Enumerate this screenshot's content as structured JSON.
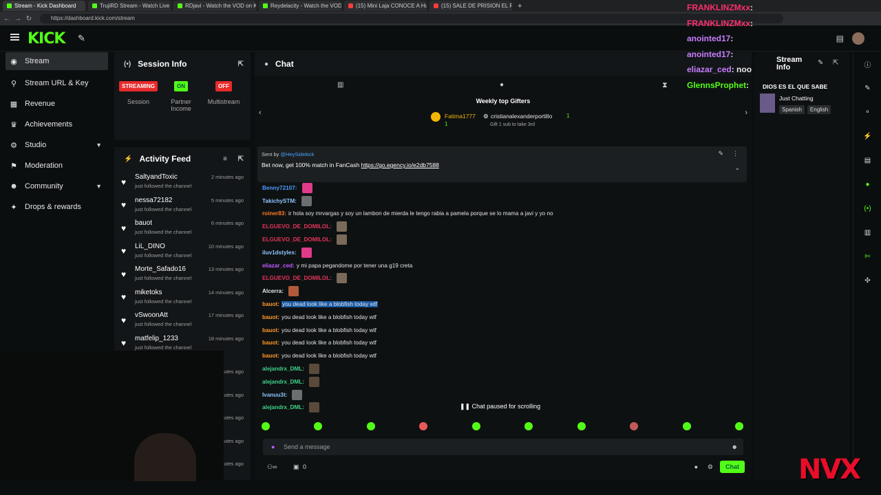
{
  "browser": {
    "tabs": [
      "Stream - Kick Dashboard",
      "TrujiRD Stream - Watch Live on Ki...",
      "RDjavi - Watch the VOD on Kick",
      "Reydelacity - Watch the VOD on ...",
      "(15) Mini Laja CONOCE A Huanc...",
      "(15) SALE DE PRISION EL FAMOSO..."
    ],
    "url": "https://dashboard.kick.com/stream"
  },
  "logo": "KICK",
  "sidebar": {
    "items": [
      {
        "label": "Stream",
        "icon": "record-icon"
      },
      {
        "label": "Stream URL & Key",
        "icon": "link-icon"
      },
      {
        "label": "Revenue",
        "icon": "revenue-icon"
      },
      {
        "label": "Achievements",
        "icon": "trophy-icon"
      },
      {
        "label": "Studio",
        "icon": "gear-icon"
      },
      {
        "label": "Moderation",
        "icon": "moderation-icon"
      },
      {
        "label": "Community",
        "icon": "community-icon"
      },
      {
        "label": "Drops & rewards",
        "icon": "gift-icon"
      }
    ]
  },
  "session": {
    "title": "Session Info",
    "streaming_badge": "STREAMING",
    "streaming_label": "Session",
    "partner_badge": "ON",
    "partner_label": "Partner Income",
    "multistream_badge": "OFF",
    "multistream_label": "Multistream"
  },
  "activity": {
    "title": "Activity Feed",
    "items": [
      {
        "name": "SaltyandToxic",
        "sub": "just followed the channel",
        "time": "2 minutes ago"
      },
      {
        "name": "nessa72182",
        "sub": "just followed the channel",
        "time": "5 minutes ago"
      },
      {
        "name": "bauot",
        "sub": "just followed the channel",
        "time": "6 minutes ago"
      },
      {
        "name": "LiL_DINO",
        "sub": "just followed the channel",
        "time": "10 minutes ago"
      },
      {
        "name": "Morte_Safado16",
        "sub": "just followed the channel",
        "time": "13 minutes ago"
      },
      {
        "name": "miketoks",
        "sub": "just followed the channel",
        "time": "14 minutes ago"
      },
      {
        "name": "vSwoonAtt",
        "sub": "just followed the channel",
        "time": "17 minutes ago"
      },
      {
        "name": "matfelip_1233",
        "sub": "just followed the channel",
        "time": "18 minutes ago"
      }
    ],
    "hidden_times": [
      "utes ago",
      "utes ago",
      "utes ago",
      "utes ago",
      "utes ago"
    ]
  },
  "chat": {
    "title": "Chat",
    "gifters_title": "Weekly top Gifters",
    "gifter1": "Fatima1777",
    "gifter1_count": "1",
    "gifter2": "cristianalexanderportillo",
    "gifter2_count": "1",
    "gift_hint": "Gift 1 sub to take 3rd",
    "pinned_sender": "Sent by",
    "pinned_handle": "@HeySidekick",
    "pinned_text": "Bet now, get 100% match in FanCash",
    "pinned_link": "https://go.egency.io/e2db7588",
    "messages": [
      {
        "user": "Benny72107:",
        "color": "#4a9cff",
        "text": "",
        "emote": true
      },
      {
        "user": "TakichySTM:",
        "color": "#8ec5ff",
        "text": "",
        "emote": true
      },
      {
        "user": "roiner83:",
        "color": "#ff7a2a",
        "text": "ir hola soy mrvargas y soy un lambon de mierda le tengo rabia a pamela porque se lo mama a javi y yo no"
      },
      {
        "user": "ELGUEVO_DE_DOMILOL:",
        "color": "#e2345a",
        "text": "",
        "emote": true
      },
      {
        "user": "ELGUEVO_DE_DOMILOL:",
        "color": "#e2345a",
        "text": "",
        "emote": true
      },
      {
        "user": "iluv1dstyles:",
        "color": "#8ec5ff",
        "text": "",
        "emote": true
      },
      {
        "user": "eliazar_ced:",
        "color": "#c05cff",
        "text": "y mi papa pegandome por tener una g19 creta"
      },
      {
        "user": "ELGUEVO_DE_DOMILOL:",
        "color": "#e2345a",
        "text": "",
        "emote": true
      },
      {
        "user": "Alcerra:",
        "color": "#e6e6e6",
        "text": "",
        "emote": true
      },
      {
        "user": "bauot:",
        "color": "#ff9a2a",
        "text": "you dead look like a blobfish today wtf"
      },
      {
        "user": "bauot:",
        "color": "#ff9a2a",
        "text": "you dead look like a blobfish today wtf"
      },
      {
        "user": "bauot:",
        "color": "#ff9a2a",
        "text": "you dead look like a blobfish today wtf"
      },
      {
        "user": "bauot:",
        "color": "#ff9a2a",
        "text": "you dead look like a blobfish today wtf"
      },
      {
        "user": "bauot:",
        "color": "#ff9a2a",
        "text": "you dead look like a blobfish today wtf"
      },
      {
        "user": "alejandrx_DML:",
        "color": "#3dd28a",
        "text": "",
        "emote": true
      },
      {
        "user": "alejandrx_DML:",
        "color": "#3dd28a",
        "text": "",
        "emote": true
      },
      {
        "user": "Ivanuu3t:",
        "color": "#8ec5ff",
        "text": "",
        "emote": true
      },
      {
        "user": "alejandrx_DML:",
        "color": "#3dd28a",
        "text": "",
        "emote": true
      }
    ],
    "paused": "Chat paused for scrolling",
    "placeholder": "Send a message",
    "points": "0",
    "send_label": "Chat"
  },
  "stream_info": {
    "title": "Stream Info",
    "stream_title": "DIOS ES EL QUE SABE",
    "category": "Just Chatting",
    "tags": [
      "Spanish",
      "English"
    ]
  },
  "overlay_chat": [
    {
      "user": "FRANKLINZMxx",
      "text": ":",
      "color": "#ff2f6d"
    },
    {
      "user": "FRANKLINZMxx",
      "text": ":",
      "color": "#ff2f6d"
    },
    {
      "user": "anointed17",
      "text": ":",
      "color": "#c77dff"
    },
    {
      "user": "anointed17",
      "text": ":",
      "color": "#c77dff"
    },
    {
      "user": "eliazar_ced",
      "text": ": noo",
      "color": "#c77dff"
    },
    {
      "user": "GlennsProphet",
      "text": ":",
      "color": "#53fc18"
    }
  ],
  "watermark": "NVX"
}
